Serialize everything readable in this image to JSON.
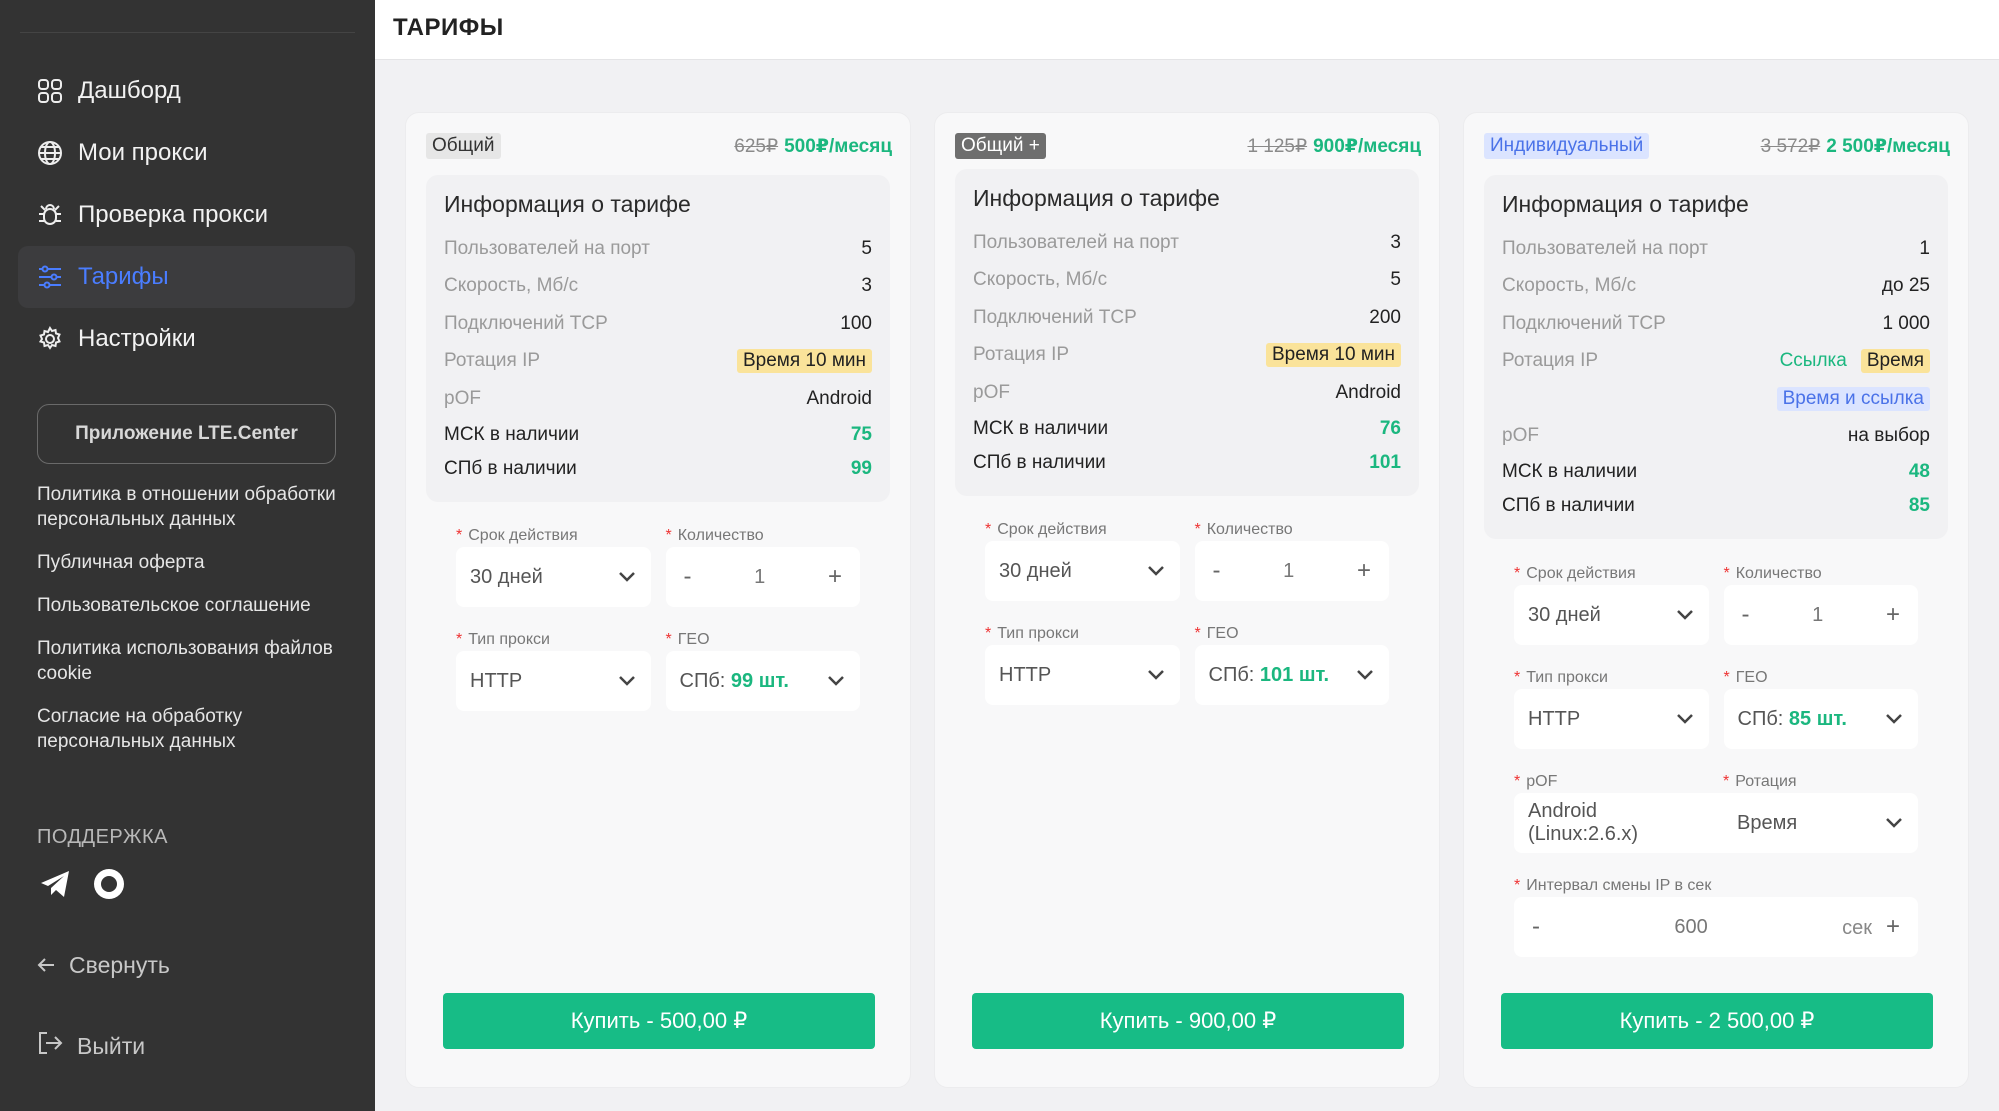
{
  "sidebar": {
    "nav": [
      {
        "label": "Дашборд",
        "icon": "dashboard-icon"
      },
      {
        "label": "Мои прокси",
        "icon": "globe-icon"
      },
      {
        "label": "Проверка прокси",
        "icon": "bug-icon"
      },
      {
        "label": "Тарифы",
        "icon": "sliders-icon",
        "active": true
      },
      {
        "label": "Настройки",
        "icon": "gear-icon"
      }
    ],
    "app_button": "Приложение LTE.Center",
    "links": [
      "Политика в отношении обработки персональных данных",
      "Публичная оферта",
      "Пользовательское соглашение",
      "Политика использования файлов cookie",
      "Согласие на обработку персональных данных"
    ],
    "support_title": "ПОДДЕРЖКА",
    "collapse_label": "Свернуть",
    "logout_label": "Выйти"
  },
  "header": {
    "title": "ТАРИФЫ"
  },
  "labels": {
    "info_title": "Информация о тарифе",
    "users_per_port": "Пользователей на порт",
    "speed": "Скорость, Мб/с",
    "tcp": "Подключений TCP",
    "rotation": "Ротация IP",
    "pof": "pOF",
    "msk": "МСК в наличии",
    "spb": "СПб в наличии",
    "term": "Срок действия",
    "qty": "Количество",
    "proxy_type": "Тип прокси",
    "geo": "ГЕО",
    "pof_field": "pOF",
    "rotation_field": "Ротация",
    "interval": "Интервал смены IP в сек"
  },
  "plans": [
    {
      "badge": "Общий",
      "old_price": "625₽",
      "new_price": "500₽/месяц",
      "users_per_port": "5",
      "speed": "3",
      "tcp": "100",
      "rotation": "Время 10 мин",
      "pof": "Android",
      "msk": "75",
      "spb": "99",
      "term": "30 дней",
      "qty": "1",
      "proxy_type": "HTTP",
      "geo_prefix": "СПб: ",
      "geo_count": "99 шт.",
      "buy": "Купить - 500,00 ₽"
    },
    {
      "badge": "Общий +",
      "old_price": "1 125₽",
      "new_price": "900₽/месяц",
      "users_per_port": "3",
      "speed": "5",
      "tcp": "200",
      "rotation": "Время 10 мин",
      "pof": "Android",
      "msk": "76",
      "spb": "101",
      "term": "30 дней",
      "qty": "1",
      "proxy_type": "HTTP",
      "geo_prefix": "СПб: ",
      "geo_count": "101 шт.",
      "buy": "Купить - 900,00 ₽"
    },
    {
      "badge": "Индивидуальный",
      "old_price": "3 572₽",
      "new_price": "2 500₽/месяц",
      "users_per_port": "1",
      "speed": "до 25",
      "tcp": "1 000",
      "rotation_link": "Ссылка",
      "rotation_time": "Время",
      "rotation_both": "Время и ссылка",
      "pof": "на выбор",
      "msk": "48",
      "spb": "85",
      "term": "30 дней",
      "qty": "1",
      "proxy_type": "HTTP",
      "geo_prefix": "СПб: ",
      "geo_count": "85 шт.",
      "pof_value": "Android (Linux:2.6.x)",
      "rotation_value": "Время",
      "interval_value": "600",
      "interval_unit": "сек",
      "buy": "Купить - 2 500,00 ₽"
    }
  ],
  "colors": {
    "accent_green": "#17bc86",
    "active_blue": "#4a7dff",
    "sidebar_bg": "#333333"
  }
}
